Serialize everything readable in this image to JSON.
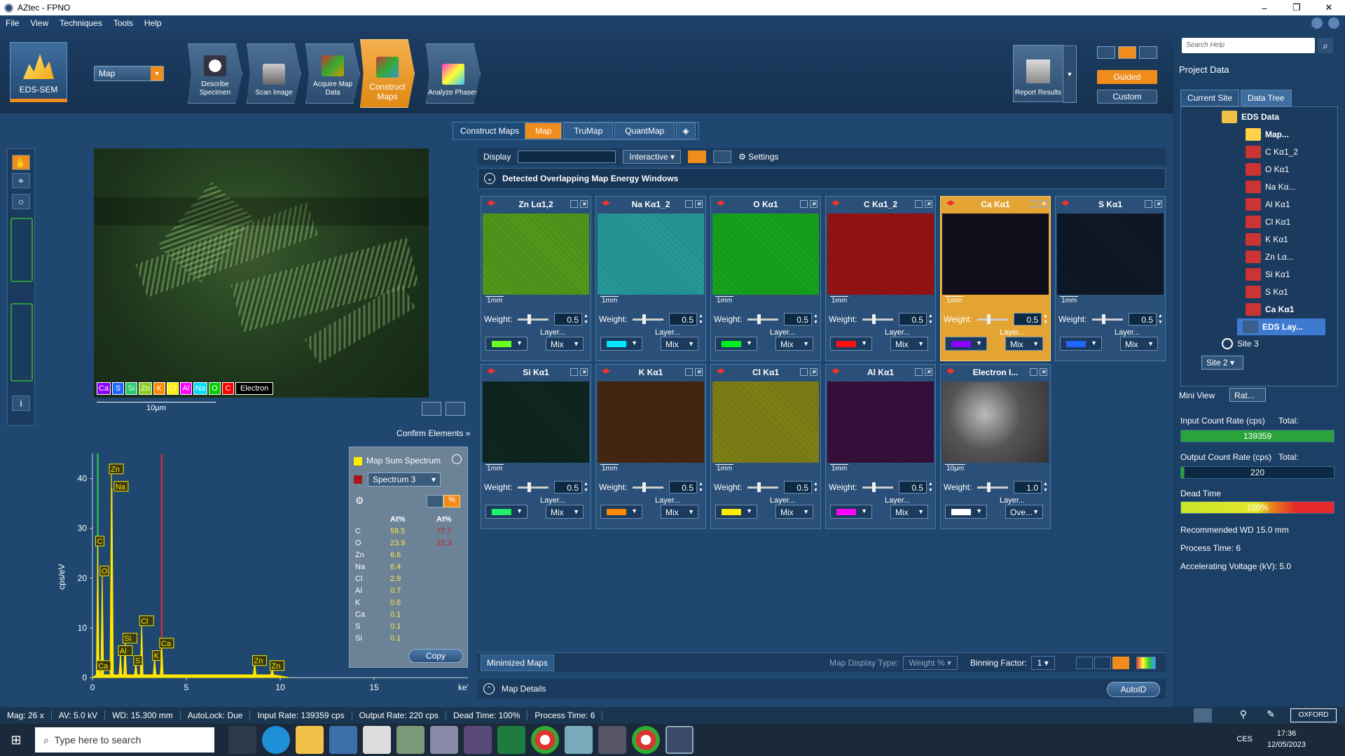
{
  "window": {
    "title": "AZtec - FPNO"
  },
  "menu": [
    "File",
    "View",
    "Techniques",
    "Tools",
    "Help"
  ],
  "ribbon": {
    "product": "EDS-SEM",
    "mode": "Map",
    "steps": [
      "Describe Specimen",
      "Scan Image",
      "Acquire Map Data",
      "Construct Maps",
      "Analyze Phases"
    ],
    "active_step": "Construct Maps",
    "report": "Report Results",
    "guided": "Guided",
    "custom": "Custom"
  },
  "right_panel": {
    "search_placeholder": "Search Help",
    "project_data": "Project Data",
    "tabs": [
      "Current Site",
      "Data Tree"
    ],
    "tree": [
      "EDS Data",
      "Map...",
      "C Kα1_2",
      "O Kα1",
      "Na Kα...",
      "Al Kα1",
      "Cl Kα1",
      "K Kα1",
      "Zn Lα...",
      "Si Kα1",
      "S Kα1",
      "Ca Kα1",
      "EDS Lay...",
      "Site 3"
    ],
    "site": "Site 2",
    "mini_view": "Mini View",
    "mini_mode": "Rat...",
    "input_count_label": "Input Count Rate (cps)",
    "input_total_label": "Total:",
    "input_count_value": "139359",
    "output_count_label": "Output Count Rate (cps)",
    "output_total_label": "Total:",
    "output_count_value": "220",
    "dead_time_label": "Dead Time",
    "dead_time_value": "100%",
    "dead_time_fraction": 1.0,
    "recommended_wd": "Recommended WD 15.0 mm",
    "process_time": "Process Time: 6",
    "accel_voltage": "Accelerating Voltage (kV): 5.0"
  },
  "image": {
    "legend": [
      "Ca",
      "S",
      "Si",
      "Zn",
      "K",
      "Cl",
      "Al",
      "Na",
      "O",
      "C",
      "Electron"
    ],
    "legend_colors": [
      "#8b00ff",
      "#1f66ff",
      "#22cc66",
      "#88cc22",
      "#ff8800",
      "#ffee00",
      "#ff00ff",
      "#00ddff",
      "#00cc00",
      "#ff0000",
      "#ffffff"
    ],
    "scale": "10µm",
    "confirm": "Confirm Elements"
  },
  "construct_bar": {
    "label": "Construct Maps",
    "tabs": [
      "Map",
      "TruMap",
      "QuantMap"
    ],
    "active": "Map"
  },
  "display_bar": {
    "label": "Display",
    "mode": "Interactive",
    "settings": "Settings"
  },
  "detected_header": "Detected Overlapping Map Energy Windows",
  "maps": [
    {
      "name": "Zn Lα1,2",
      "scale": "1mm",
      "weight": "0.5",
      "mix": "Mix",
      "color": "#66ff22",
      "tint": "#5aa51e"
    },
    {
      "name": "Na Kα1_2",
      "scale": "1mm",
      "weight": "0.5",
      "mix": "Mix",
      "color": "#00e6ff",
      "tint": "#2aa6a6"
    },
    {
      "name": "O Kα1",
      "scale": "1mm",
      "weight": "0.5",
      "mix": "Mix",
      "color": "#00ee22",
      "tint": "#19b21f"
    },
    {
      "name": "C Kα1_2",
      "scale": "1mm",
      "weight": "0.5",
      "mix": "Mix",
      "color": "#ff1010",
      "tint": "#a31414"
    },
    {
      "name": "Ca Kα1",
      "scale": "1mm",
      "weight": "0.5",
      "mix": "Mix",
      "color": "#8b00ff",
      "tint": "#12101e"
    },
    {
      "name": "S Kα1",
      "scale": "1mm",
      "weight": "0.5",
      "mix": "Mix",
      "color": "#1f66ff",
      "tint": "#0f1a2a"
    },
    {
      "name": "Si Kα1",
      "scale": "1mm",
      "weight": "0.5",
      "mix": "Mix",
      "color": "#22ee66",
      "tint": "#0f2a22"
    },
    {
      "name": "K Kα1",
      "scale": "1mm",
      "weight": "0.5",
      "mix": "Mix",
      "color": "#ff8800",
      "tint": "#4a2a12"
    },
    {
      "name": "Cl Kα1",
      "scale": "1mm",
      "weight": "0.5",
      "mix": "Mix",
      "color": "#ffee00",
      "tint": "#8a8a18"
    },
    {
      "name": "Al Kα1",
      "scale": "1mm",
      "weight": "0.5",
      "mix": "Mix",
      "color": "#ff00ff",
      "tint": "#3a1040"
    },
    {
      "name": "Electron I...",
      "scale": "10µm",
      "weight": "1.0",
      "mix": "Ove...",
      "color": "#ffffff",
      "tint": "#6a6a6a"
    }
  ],
  "map_labels": {
    "weight": "Weight:",
    "layer": "Layer..."
  },
  "spectrum": {
    "sum_label": "Map Sum Spectrum",
    "spectrum_label": "Spectrum 3",
    "col1": "At%",
    "col2": "At%",
    "rows": [
      {
        "el": "C",
        "v1": "58.5",
        "v2": "77.7"
      },
      {
        "el": "O",
        "v1": "23.9",
        "v2": "22.3"
      },
      {
        "el": "Zn",
        "v1": "6.6",
        "v2": ""
      },
      {
        "el": "Na",
        "v1": "6.4",
        "v2": ""
      },
      {
        "el": "Cl",
        "v1": "2.9",
        "v2": ""
      },
      {
        "el": "Al",
        "v1": "0.7",
        "v2": ""
      },
      {
        "el": "K",
        "v1": "0.6",
        "v2": ""
      },
      {
        "el": "Ca",
        "v1": "0.1",
        "v2": ""
      },
      {
        "el": "S",
        "v1": "0.1",
        "v2": ""
      },
      {
        "el": "Si",
        "v1": "0.1",
        "v2": ""
      }
    ],
    "copy": "Copy"
  },
  "chart_data": {
    "type": "line",
    "xlabel": "keV",
    "ylabel": "cps/eV",
    "xlim": [
      0,
      20
    ],
    "ylim": [
      0,
      45
    ],
    "x_ticks": [
      0,
      5,
      10,
      15
    ],
    "y_ticks": [
      0,
      10,
      20,
      30,
      40
    ],
    "peaks": [
      {
        "label": "Zn",
        "x": 1.01,
        "y": 41.5
      },
      {
        "label": "Na",
        "x": 1.04,
        "y": 38.0
      },
      {
        "label": "C",
        "x": 0.28,
        "y": 27.0
      },
      {
        "label": "O",
        "x": 0.52,
        "y": 21.0
      },
      {
        "label": "Cl",
        "x": 2.62,
        "y": 11.0
      },
      {
        "label": "Si",
        "x": 1.74,
        "y": 7.5
      },
      {
        "label": "Al",
        "x": 1.49,
        "y": 5.0
      },
      {
        "label": "S",
        "x": 2.31,
        "y": 3.0
      },
      {
        "label": "K",
        "x": 3.31,
        "y": 4.0
      },
      {
        "label": "Ca",
        "x": 3.69,
        "y": 6.5
      },
      {
        "label": "Ca",
        "x": 0.34,
        "y": 2.0
      },
      {
        "label": "Zn",
        "x": 8.64,
        "y": 3.0
      },
      {
        "label": "Zn",
        "x": 9.57,
        "y": 2.0
      }
    ]
  },
  "bottom": {
    "minimized": "Minimized Maps",
    "display_type_label": "Map Display Type:",
    "display_type": "Weight %",
    "binning_label": "Binning Factor:",
    "binning": "1",
    "details": "Map Details",
    "autoid": "AutoID"
  },
  "status": [
    "Mag: 26 x",
    "AV: 5.0 kV",
    "WD: 15.300 mm",
    "AutoLock: Due",
    "Input Rate: 139359 cps",
    "Output Rate: 220 cps",
    "Dead Time: 100%",
    "Process Time: 6"
  ],
  "oxford": "OXFORD INSTRUMENTS",
  "taskbar": {
    "search": "Type here to search",
    "lang": "CES",
    "time": "17:36",
    "date": "12/05/2023"
  }
}
